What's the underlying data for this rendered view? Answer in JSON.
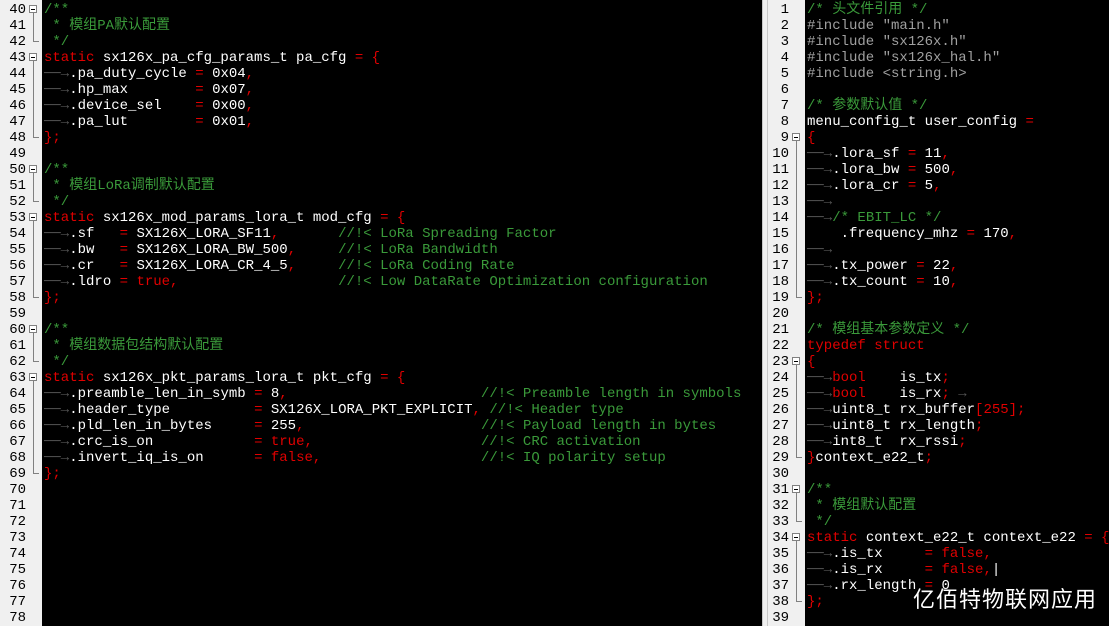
{
  "left_pane": {
    "lines": [
      {
        "num": "40",
        "fold": "box",
        "segs": [
          [
            "cm",
            "/**"
          ]
        ]
      },
      {
        "num": "41",
        "fold": "v",
        "segs": [
          [
            "cm",
            " * 模组PA默认配置"
          ]
        ]
      },
      {
        "num": "42",
        "fold": "end",
        "segs": [
          [
            "cm",
            " */"
          ]
        ]
      },
      {
        "num": "43",
        "fold": "box",
        "segs": [
          [
            "kw",
            "static "
          ],
          [
            "tx",
            "sx126x_pa_cfg_params_t pa_cfg "
          ],
          [
            "kw",
            "= {"
          ]
        ]
      },
      {
        "num": "44",
        "fold": "v",
        "segs": [
          [
            "dim",
            "──→"
          ],
          [
            "tx",
            ".pa_duty_cycle "
          ],
          [
            "kw",
            "= "
          ],
          [
            "tx",
            "0x04"
          ],
          [
            "kw",
            ","
          ]
        ]
      },
      {
        "num": "45",
        "fold": "v",
        "segs": [
          [
            "dim",
            "──→"
          ],
          [
            "tx",
            ".hp_max        "
          ],
          [
            "kw",
            "= "
          ],
          [
            "tx",
            "0x07"
          ],
          [
            "kw",
            ","
          ]
        ]
      },
      {
        "num": "46",
        "fold": "v",
        "segs": [
          [
            "dim",
            "──→"
          ],
          [
            "tx",
            ".device_sel    "
          ],
          [
            "kw",
            "= "
          ],
          [
            "tx",
            "0x00"
          ],
          [
            "kw",
            ","
          ]
        ]
      },
      {
        "num": "47",
        "fold": "v",
        "segs": [
          [
            "dim",
            "──→"
          ],
          [
            "tx",
            ".pa_lut        "
          ],
          [
            "kw",
            "= "
          ],
          [
            "tx",
            "0x01"
          ],
          [
            "kw",
            ","
          ]
        ]
      },
      {
        "num": "48",
        "fold": "end",
        "segs": [
          [
            "kw",
            "};"
          ]
        ]
      },
      {
        "num": "49",
        "fold": "",
        "segs": []
      },
      {
        "num": "50",
        "fold": "box",
        "segs": [
          [
            "cm",
            "/**"
          ]
        ]
      },
      {
        "num": "51",
        "fold": "v",
        "segs": [
          [
            "cm",
            " * 模组LoRa调制默认配置"
          ]
        ]
      },
      {
        "num": "52",
        "fold": "end",
        "segs": [
          [
            "cm",
            " */"
          ]
        ]
      },
      {
        "num": "53",
        "fold": "box",
        "segs": [
          [
            "kw",
            "static "
          ],
          [
            "tx",
            "sx126x_mod_params_lora_t mod_cfg "
          ],
          [
            "kw",
            "= {"
          ]
        ]
      },
      {
        "num": "54",
        "fold": "v",
        "segs": [
          [
            "dim",
            "──→"
          ],
          [
            "tx",
            ".sf   "
          ],
          [
            "kw",
            "= "
          ],
          [
            "tx",
            "SX126X_LORA_SF11"
          ],
          [
            "kw",
            ","
          ],
          [
            "tx",
            "       "
          ],
          [
            "cm",
            "//!< LoRa Spreading Factor"
          ]
        ]
      },
      {
        "num": "55",
        "fold": "v",
        "segs": [
          [
            "dim",
            "──→"
          ],
          [
            "tx",
            ".bw   "
          ],
          [
            "kw",
            "= "
          ],
          [
            "tx",
            "SX126X_LORA_BW_500"
          ],
          [
            "kw",
            ","
          ],
          [
            "tx",
            "     "
          ],
          [
            "cm",
            "//!< LoRa Bandwidth"
          ]
        ]
      },
      {
        "num": "56",
        "fold": "v",
        "segs": [
          [
            "dim",
            "──→"
          ],
          [
            "tx",
            ".cr   "
          ],
          [
            "kw",
            "= "
          ],
          [
            "tx",
            "SX126X_LORA_CR_4_5"
          ],
          [
            "kw",
            ","
          ],
          [
            "tx",
            "     "
          ],
          [
            "cm",
            "//!< LoRa Coding Rate"
          ]
        ]
      },
      {
        "num": "57",
        "fold": "v",
        "segs": [
          [
            "dim",
            "──→"
          ],
          [
            "tx",
            ".ldro "
          ],
          [
            "kw",
            "= true,"
          ],
          [
            "tx",
            "                   "
          ],
          [
            "cm",
            "//!< Low DataRate Optimization configuration"
          ]
        ]
      },
      {
        "num": "58",
        "fold": "end",
        "segs": [
          [
            "kw",
            "};"
          ]
        ]
      },
      {
        "num": "59",
        "fold": "",
        "segs": []
      },
      {
        "num": "60",
        "fold": "box",
        "segs": [
          [
            "cm",
            "/**"
          ]
        ]
      },
      {
        "num": "61",
        "fold": "v",
        "segs": [
          [
            "cm",
            " * 模组数据包结构默认配置"
          ]
        ]
      },
      {
        "num": "62",
        "fold": "end",
        "segs": [
          [
            "cm",
            " */"
          ]
        ]
      },
      {
        "num": "63",
        "fold": "box",
        "segs": [
          [
            "kw",
            "static "
          ],
          [
            "tx",
            "sx126x_pkt_params_lora_t pkt_cfg "
          ],
          [
            "kw",
            "= {"
          ]
        ]
      },
      {
        "num": "64",
        "fold": "v",
        "segs": [
          [
            "dim",
            "──→"
          ],
          [
            "tx",
            ".preamble_len_in_symb "
          ],
          [
            "kw",
            "= "
          ],
          [
            "tx",
            "8"
          ],
          [
            "kw",
            ","
          ],
          [
            "tx",
            "                       "
          ],
          [
            "cm",
            "//!< Preamble length in symbols"
          ]
        ]
      },
      {
        "num": "65",
        "fold": "v",
        "segs": [
          [
            "dim",
            "──→"
          ],
          [
            "tx",
            ".header_type          "
          ],
          [
            "kw",
            "= "
          ],
          [
            "tx",
            "SX126X_LORA_PKT_EXPLICIT"
          ],
          [
            "kw",
            ","
          ],
          [
            "tx",
            " "
          ],
          [
            "cm",
            "//!< Header type"
          ]
        ]
      },
      {
        "num": "66",
        "fold": "v",
        "segs": [
          [
            "dim",
            "──→"
          ],
          [
            "tx",
            ".pld_len_in_bytes     "
          ],
          [
            "kw",
            "= "
          ],
          [
            "tx",
            "255"
          ],
          [
            "kw",
            ","
          ],
          [
            "tx",
            "                     "
          ],
          [
            "cm",
            "//!< Payload length in bytes"
          ]
        ]
      },
      {
        "num": "67",
        "fold": "v",
        "segs": [
          [
            "dim",
            "──→"
          ],
          [
            "tx",
            ".crc_is_on            "
          ],
          [
            "kw",
            "= true,"
          ],
          [
            "tx",
            "                    "
          ],
          [
            "cm",
            "//!< CRC activation"
          ]
        ]
      },
      {
        "num": "68",
        "fold": "v",
        "segs": [
          [
            "dim",
            "──→"
          ],
          [
            "tx",
            ".invert_iq_is_on      "
          ],
          [
            "kw",
            "= false,"
          ],
          [
            "tx",
            "                   "
          ],
          [
            "cm",
            "//!< IQ polarity setup"
          ]
        ]
      },
      {
        "num": "69",
        "fold": "end",
        "segs": [
          [
            "kw",
            "};"
          ]
        ]
      },
      {
        "num": "70",
        "fold": "",
        "segs": []
      },
      {
        "num": "71",
        "fold": "",
        "segs": []
      },
      {
        "num": "72",
        "fold": "",
        "segs": []
      },
      {
        "num": "73",
        "fold": "",
        "segs": []
      },
      {
        "num": "74",
        "fold": "",
        "segs": []
      },
      {
        "num": "75",
        "fold": "",
        "segs": []
      },
      {
        "num": "76",
        "fold": "",
        "segs": []
      },
      {
        "num": "77",
        "fold": "",
        "segs": []
      },
      {
        "num": "78",
        "fold": "",
        "segs": []
      }
    ]
  },
  "right_pane": {
    "lines": [
      {
        "num": "1",
        "fold": "",
        "segs": [
          [
            "cm",
            "/* 头文件引用 */"
          ]
        ]
      },
      {
        "num": "2",
        "fold": "",
        "segs": [
          [
            "pp",
            "#include \"main.h\""
          ]
        ]
      },
      {
        "num": "3",
        "fold": "",
        "segs": [
          [
            "pp",
            "#include \"sx126x.h\""
          ]
        ]
      },
      {
        "num": "4",
        "fold": "",
        "segs": [
          [
            "pp",
            "#include \"sx126x_hal.h\""
          ]
        ]
      },
      {
        "num": "5",
        "fold": "",
        "segs": [
          [
            "pp",
            "#include <string.h>"
          ]
        ]
      },
      {
        "num": "6",
        "fold": "",
        "segs": []
      },
      {
        "num": "7",
        "fold": "",
        "segs": [
          [
            "cm",
            "/* 参数默认值 */"
          ]
        ]
      },
      {
        "num": "8",
        "fold": "",
        "segs": [
          [
            "tx",
            "menu_config_t user_config "
          ],
          [
            "kw",
            "="
          ]
        ]
      },
      {
        "num": "9",
        "fold": "box",
        "segs": [
          [
            "kw",
            "{"
          ]
        ]
      },
      {
        "num": "10",
        "fold": "v",
        "segs": [
          [
            "dim",
            "──→"
          ],
          [
            "tx",
            ".lora_sf "
          ],
          [
            "kw",
            "= "
          ],
          [
            "tx",
            "11"
          ],
          [
            "kw",
            ","
          ]
        ]
      },
      {
        "num": "11",
        "fold": "v",
        "segs": [
          [
            "dim",
            "──→"
          ],
          [
            "tx",
            ".lora_bw "
          ],
          [
            "kw",
            "= "
          ],
          [
            "tx",
            "500"
          ],
          [
            "kw",
            ","
          ]
        ]
      },
      {
        "num": "12",
        "fold": "v",
        "segs": [
          [
            "dim",
            "──→"
          ],
          [
            "tx",
            ".lora_cr "
          ],
          [
            "kw",
            "= "
          ],
          [
            "tx",
            "5"
          ],
          [
            "kw",
            ","
          ]
        ]
      },
      {
        "num": "13",
        "fold": "v",
        "segs": [
          [
            "dim",
            "──→"
          ]
        ]
      },
      {
        "num": "14",
        "fold": "v",
        "segs": [
          [
            "dim",
            "──→"
          ],
          [
            "cm",
            "/* EBIT_LC */"
          ]
        ]
      },
      {
        "num": "15",
        "fold": "v",
        "segs": [
          [
            "tx",
            "    .frequency_mhz "
          ],
          [
            "kw",
            "= "
          ],
          [
            "tx",
            "170"
          ],
          [
            "kw",
            ","
          ]
        ]
      },
      {
        "num": "16",
        "fold": "v",
        "segs": [
          [
            "dim",
            "──→"
          ]
        ]
      },
      {
        "num": "17",
        "fold": "v",
        "segs": [
          [
            "dim",
            "──→"
          ],
          [
            "tx",
            ".tx_power "
          ],
          [
            "kw",
            "= "
          ],
          [
            "tx",
            "22"
          ],
          [
            "kw",
            ","
          ]
        ]
      },
      {
        "num": "18",
        "fold": "v",
        "segs": [
          [
            "dim",
            "──→"
          ],
          [
            "tx",
            ".tx_count "
          ],
          [
            "kw",
            "= "
          ],
          [
            "tx",
            "10"
          ],
          [
            "kw",
            ","
          ]
        ]
      },
      {
        "num": "19",
        "fold": "end",
        "segs": [
          [
            "kw",
            "};"
          ]
        ]
      },
      {
        "num": "20",
        "fold": "",
        "segs": []
      },
      {
        "num": "21",
        "fold": "",
        "segs": [
          [
            "cm",
            "/* 模组基本参数定义 */"
          ]
        ]
      },
      {
        "num": "22",
        "fold": "",
        "segs": [
          [
            "kw",
            "typedef struct"
          ]
        ]
      },
      {
        "num": "23",
        "fold": "box",
        "segs": [
          [
            "kw",
            "{"
          ]
        ]
      },
      {
        "num": "24",
        "fold": "v",
        "segs": [
          [
            "dim",
            "──→"
          ],
          [
            "kw",
            "bool    "
          ],
          [
            "tx",
            "is_tx"
          ],
          [
            "kw",
            ";"
          ]
        ]
      },
      {
        "num": "25",
        "fold": "v",
        "segs": [
          [
            "dim",
            "──→"
          ],
          [
            "kw",
            "bool    "
          ],
          [
            "tx",
            "is_rx"
          ],
          [
            "kw",
            ";"
          ],
          [
            "dim",
            " →"
          ]
        ]
      },
      {
        "num": "26",
        "fold": "v",
        "segs": [
          [
            "dim",
            "──→"
          ],
          [
            "tx",
            "uint8_t rx_buffer"
          ],
          [
            "kw",
            "[255];"
          ]
        ]
      },
      {
        "num": "27",
        "fold": "v",
        "segs": [
          [
            "dim",
            "──→"
          ],
          [
            "tx",
            "uint8_t rx_length"
          ],
          [
            "kw",
            ";"
          ]
        ]
      },
      {
        "num": "28",
        "fold": "v",
        "segs": [
          [
            "dim",
            "──→"
          ],
          [
            "tx",
            "int8_t  rx_rssi"
          ],
          [
            "kw",
            ";"
          ]
        ]
      },
      {
        "num": "29",
        "fold": "end",
        "segs": [
          [
            "kw",
            "}"
          ],
          [
            "tx",
            "context_e22_t"
          ],
          [
            "kw",
            ";"
          ]
        ]
      },
      {
        "num": "30",
        "fold": "",
        "segs": []
      },
      {
        "num": "31",
        "fold": "box",
        "segs": [
          [
            "cm",
            "/**"
          ]
        ]
      },
      {
        "num": "32",
        "fold": "v",
        "segs": [
          [
            "cm",
            " * 模组默认配置"
          ]
        ]
      },
      {
        "num": "33",
        "fold": "end",
        "segs": [
          [
            "cm",
            " */"
          ]
        ]
      },
      {
        "num": "34",
        "fold": "box",
        "segs": [
          [
            "kw",
            "static "
          ],
          [
            "tx",
            "context_e22_t context_e22 "
          ],
          [
            "kw",
            "= {"
          ]
        ]
      },
      {
        "num": "35",
        "fold": "v",
        "segs": [
          [
            "dim",
            "──→"
          ],
          [
            "tx",
            ".is_tx     "
          ],
          [
            "kw",
            "= false,"
          ]
        ]
      },
      {
        "num": "36",
        "fold": "v",
        "segs": [
          [
            "dim",
            "──→"
          ],
          [
            "tx",
            ".is_rx     "
          ],
          [
            "kw",
            "= false,"
          ],
          [
            "tx",
            "|"
          ]
        ]
      },
      {
        "num": "37",
        "fold": "v",
        "segs": [
          [
            "dim",
            "──→"
          ],
          [
            "tx",
            ".rx_length "
          ],
          [
            "kw",
            "= "
          ],
          [
            "tx",
            "0"
          ]
        ]
      },
      {
        "num": "38",
        "fold": "end",
        "segs": [
          [
            "kw",
            "};"
          ]
        ]
      },
      {
        "num": "39",
        "fold": "",
        "segs": []
      }
    ]
  },
  "watermark": "亿佰特物联网应用"
}
